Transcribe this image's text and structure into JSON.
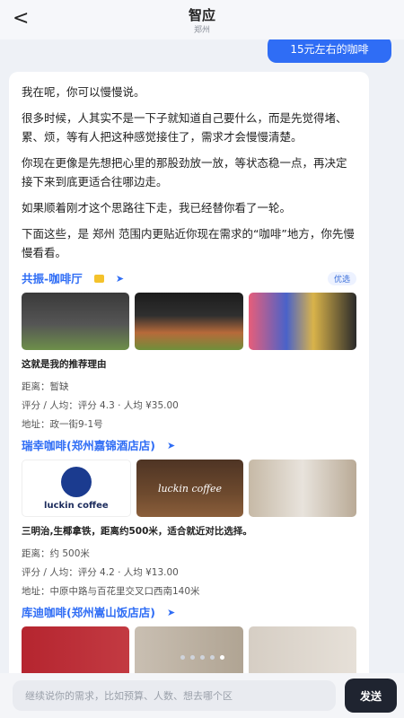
{
  "header": {
    "back_icon": "chevron-left-icon",
    "back_glyph": "<",
    "title": "智应",
    "subtitle": "郑州"
  },
  "user_message": "15元左右的咖啡",
  "reply": {
    "paragraphs": [
      "我在呢，你可以慢慢说。",
      "很多时候，人其实不是一下子就知道自己要什么，而是先觉得堵、累、烦，等有人把这种感觉接住了，需求才会慢慢清楚。",
      "你现在更像是先想把心里的那股劲放一放，等状态稳一点，再决定接下来到底更适合往哪边走。",
      "如果顺着刚才这个思路往下走，我已经替你看了一轮。",
      "下面这些，是 郑州 范围内更贴近你现在需求的“咖啡”地方，你先慢慢看看。"
    ],
    "places": [
      {
        "name": "共振-咖啡厅",
        "badge": "优选",
        "reason": "这就是我的推荐理由",
        "distance": "距离：暂缺",
        "rating": "评分 / 人均：评分 4.3 · 人均 ¥35.00",
        "address": "地址：政一街9-1号"
      },
      {
        "name": "瑞幸咖啡(郑州嘉锦酒店店)",
        "logo_text": "luckin coffee",
        "sign_text": "luckin coffee",
        "reason": "三明治,生椰拿铁，距离约500米，适合就近对比选择。",
        "distance": "距离：约 500米",
        "rating": "评分 / 人均：评分 4.2 · 人均 ¥13.00",
        "address": "地址：中原中路与百花里交叉口西南140米"
      },
      {
        "name": "库迪咖啡(郑州嵩山饭店店)"
      }
    ]
  },
  "footer": {
    "input_placeholder": "继续说你的需求，比如预算、人数、想去哪个区",
    "send_label": "发送"
  },
  "colors": {
    "accent": "#2f6df5",
    "send_button": "#1f2430"
  }
}
